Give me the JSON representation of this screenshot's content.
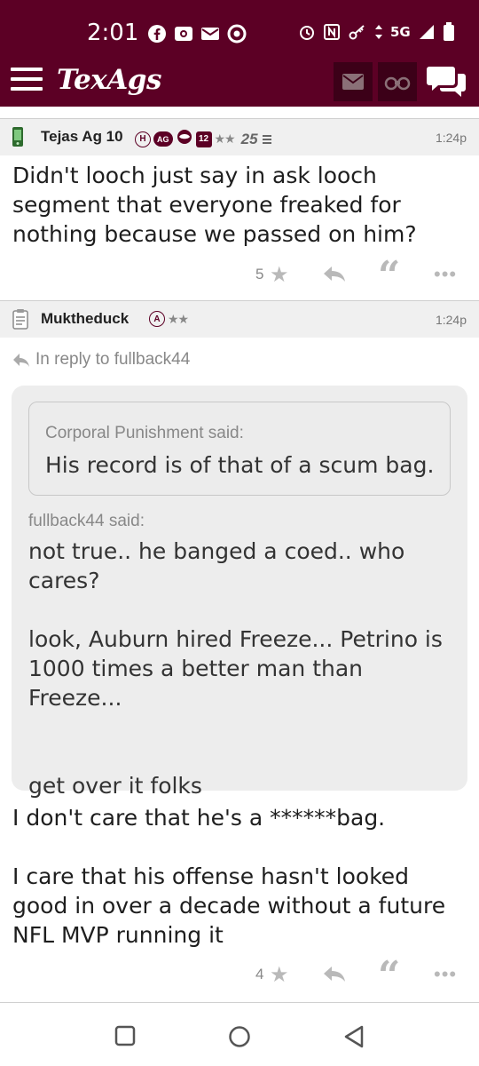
{
  "status_bar": {
    "time": "2:01",
    "network": "5G",
    "icons_left": [
      "facebook-icon",
      "radio-icon",
      "mail-icon",
      "chrome-icon"
    ],
    "icons_right": [
      "alarm-icon",
      "nfc-icon",
      "key-icon",
      "data-arrows-icon",
      "signal-icon",
      "battery-icon"
    ]
  },
  "app_bar": {
    "brand": "TexAgs",
    "colors": {
      "maroon": "#5c0025",
      "button_dark": "#3c0018"
    }
  },
  "posts": [
    {
      "username": "Tejas Ag 10",
      "badges": [
        "H",
        "AG",
        "12"
      ],
      "stars": "★★",
      "rank": "25",
      "time": "1:24p",
      "body": "Didn't looch just say in ask looch segment that everyone freaked for nothing because we passed on him?",
      "likes": "5"
    },
    {
      "username": "Muktheduck",
      "badges": [
        "A"
      ],
      "stars": "★★",
      "time": "1:24p",
      "in_reply_to": "In reply to fullback44",
      "nested_quote": {
        "attribution": "Corporal Punishment said:",
        "text": "His record is of that of a scum bag."
      },
      "quote": {
        "attribution": "fullback44 said:",
        "text": "not true.. he banged a coed.. who cares?\n\nlook, Auburn hired Freeze... Petrino is 1000 times a better man than Freeze...\n\n\nget over it folks"
      },
      "body": "I don't care that he's a ******bag.\n\nI care that his offense hasn't looked good in over a decade without a future NFL MVP running it",
      "likes": "4"
    }
  ],
  "nav_bar": [
    "recents-button",
    "home-button",
    "back-button"
  ]
}
